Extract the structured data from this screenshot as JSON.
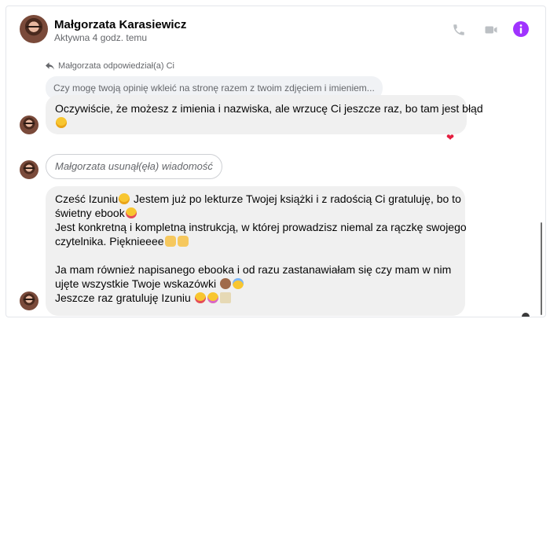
{
  "header": {
    "name": "Małgorzata Karasiewicz",
    "status": "Aktywna 4 godz. temu",
    "icons": [
      "phone-icon",
      "video-camera-icon",
      "info-icon"
    ],
    "accent_color": "#a033ff"
  },
  "thread": {
    "reply_note": "Małgorzata odpowiedział(a) Ci",
    "quoted_message": "Czy mogę twoją opinię wkleić na stronę razem z twoim zdjęciem i imieniem...",
    "message1": {
      "line1": "Oczywiście, że możesz z imienia i nazwiska, ale wrzucę Ci jeszcze raz, bo tam jest błąd",
      "emoji": "smile"
    },
    "reaction": "❤",
    "removed_notice": "Małgorzata usunął(ęła) wiadomość",
    "message2": {
      "line1": "Cześć Izuniu",
      "line1b": " Jestem już po lekturze Twojej książki i z radością Ci gratuluję, bo to",
      "line2": "świetny  ebook",
      "line3": "Jest konkretną i kompletną instrukcją, w której prowadzisz niemal za rączkę swojego",
      "line4": "czytelnika. Pięknieeee",
      "line5": "Ja mam również napisanego ebooka i od razu zastanawiałam się czy mam w nim",
      "line6": "ujęte wszystkie Twoje wskazówki ",
      "line7": "Jeszcze raz gratuluję Izuniu "
    }
  }
}
